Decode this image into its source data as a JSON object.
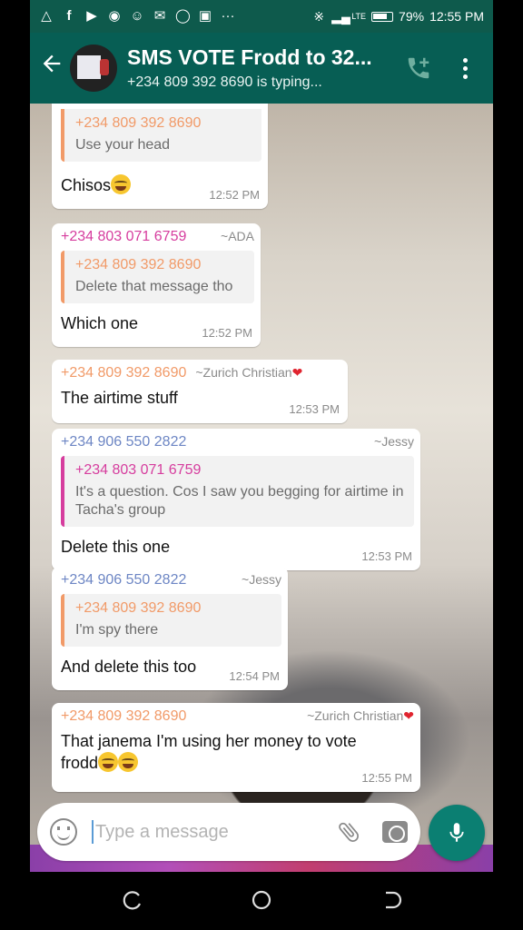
{
  "status_bar": {
    "battery": "79%",
    "time": "12:55 PM",
    "network": "LTE",
    "battery_level": 0.79
  },
  "header": {
    "title": "SMS VOTE Frodd to 32...",
    "subtitle": "+234 809 392 8690 is typing...",
    "icons": [
      "back-arrow-icon",
      "add-call-icon",
      "more-options-icon"
    ]
  },
  "messages": [
    {
      "quote": {
        "number": "+234 809 392 8690",
        "text": "Use your head"
      },
      "text": "Chisos",
      "emoji_count": 1,
      "time": "12:52 PM"
    },
    {
      "sender": "+234 803 071 6759",
      "alias": "~ADA",
      "quote": {
        "number": "+234 809 392 8690",
        "text": "Delete that message tho"
      },
      "text": "Which one",
      "time": "12:52 PM"
    },
    {
      "sender": "+234 809 392 8690",
      "alias": "~Zurich Christian",
      "alias_emoji": "red-heart",
      "text": "The airtime stuff",
      "time": "12:53 PM"
    },
    {
      "sender": "+234 906 550 2822",
      "alias": "~Jessy",
      "quote": {
        "number": "+234 803 071 6759",
        "text": "It's a question. Cos I saw you begging for airtime in Tacha's group"
      },
      "text": "Delete this one",
      "time": "12:53 PM"
    },
    {
      "sender": "+234 906 550 2822",
      "alias": "~Jessy",
      "quote": {
        "number": "+234 809 392 8690",
        "text": "I'm spy there"
      },
      "text": "And delete this too",
      "time": "12:54 PM"
    },
    {
      "sender": "+234 809 392 8690",
      "alias": "~Zurich Christian",
      "alias_emoji": "red-heart",
      "text": "That janema I'm using her money to vote frodd",
      "emoji_count": 2,
      "time": "12:55 PM"
    }
  ],
  "composer": {
    "placeholder": "Type a message"
  },
  "colors": {
    "header": "#075e54",
    "status_bar": "#0e5a4c",
    "sender_orange": "#f19a68",
    "sender_pink": "#d63d9e",
    "sender_blue": "#6d86c4",
    "mic_button": "#0b7f72"
  }
}
